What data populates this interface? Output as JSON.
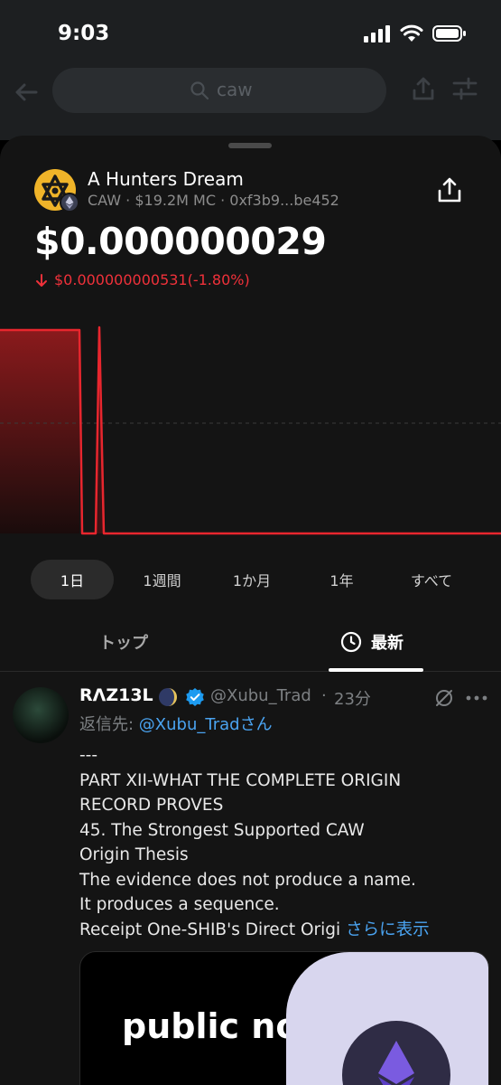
{
  "status_bar": {
    "time": "9:03"
  },
  "search": {
    "query": "caw"
  },
  "token": {
    "name": "A Hunters Dream",
    "symbol": "CAW",
    "market_cap": "$19.2M MC",
    "address": "0xf3b9...be452",
    "price": "$0.000000029",
    "change": "$0.000000000531(-1.80%)",
    "colors": {
      "negative": "#f0313a",
      "logo": "#f0b429"
    }
  },
  "chart_data": {
    "type": "line",
    "title": "",
    "xlabel": "",
    "ylabel": "",
    "series": [
      {
        "values": [
          2.95e-08,
          2.95e-08,
          2.95e-08,
          2.9e-08,
          2.95e-08,
          2.9e-08,
          2.9e-08,
          2.9e-08,
          2.9e-08
        ]
      }
    ],
    "grid": false
  },
  "ranges": [
    {
      "label": "1日",
      "active": true
    },
    {
      "label": "1週間",
      "active": false
    },
    {
      "label": "1か月",
      "active": false
    },
    {
      "label": "1年",
      "active": false
    },
    {
      "label": "すべて",
      "active": false
    }
  ],
  "tabs": {
    "top": "トップ",
    "latest": "最新"
  },
  "post": {
    "author": "RΛZ13L",
    "handle": "@Xubu_Trad",
    "separator": "·",
    "time": "23分",
    "reply_prefix": "返信先: ",
    "reply_mention": "@Xubu_Tradさん",
    "lines": [
      "---",
      "PART XII-WHAT THE COMPLETE ORIGIN",
      "RECORD PROVES",
      "45. The Strongest Supported CAW",
      "Origin Thesis",
      "The evidence does not produce a name.",
      "It produces a sequence."
    ],
    "last_line": "Receipt One-SHIB's Direct Origi ",
    "show_more": "さらに表示",
    "media_text": "public node"
  }
}
